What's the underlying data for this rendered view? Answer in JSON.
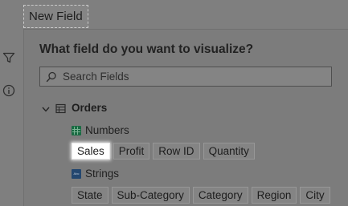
{
  "field_pill": {
    "label": "New Field"
  },
  "panel": {
    "question": "What field do you want to visualize?",
    "search": {
      "placeholder": "Search Fields",
      "value": ""
    },
    "datasource": {
      "name": "Orders",
      "expanded": true,
      "groups": [
        {
          "label": "Numbers",
          "icon": "number-type-icon",
          "icon_color": "#1a6b43",
          "fields": [
            "Sales",
            "Profit",
            "Row ID",
            "Quantity"
          ],
          "highlighted": "Sales"
        },
        {
          "label": "Strings",
          "icon": "string-type-icon",
          "icon_color": "#24476f",
          "fields": [
            "State",
            "Sub-Category",
            "Category",
            "Region",
            "City"
          ]
        }
      ]
    }
  },
  "colors": {
    "overlay": "#7f7f7f",
    "highlight": "#ffffff"
  }
}
